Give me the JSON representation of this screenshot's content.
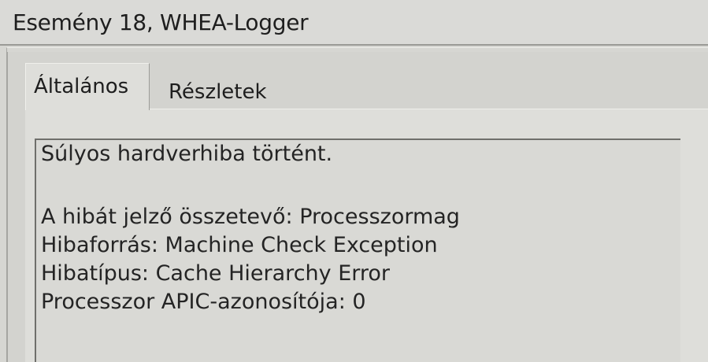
{
  "window": {
    "title": "Esemény 18, WHEA-Logger"
  },
  "tabs": [
    {
      "label": "Általános",
      "active": true
    },
    {
      "label": "Részletek",
      "active": false
    }
  ],
  "description": {
    "lines": [
      "Súlyos hardverhiba történt.",
      "A hibát jelző összetevő: Processzormag",
      "Hibaforrás: Machine Check Exception",
      "Hibatípus: Cache Hierarchy Error",
      "Processzor APIC-azonosítója: 0"
    ]
  }
}
